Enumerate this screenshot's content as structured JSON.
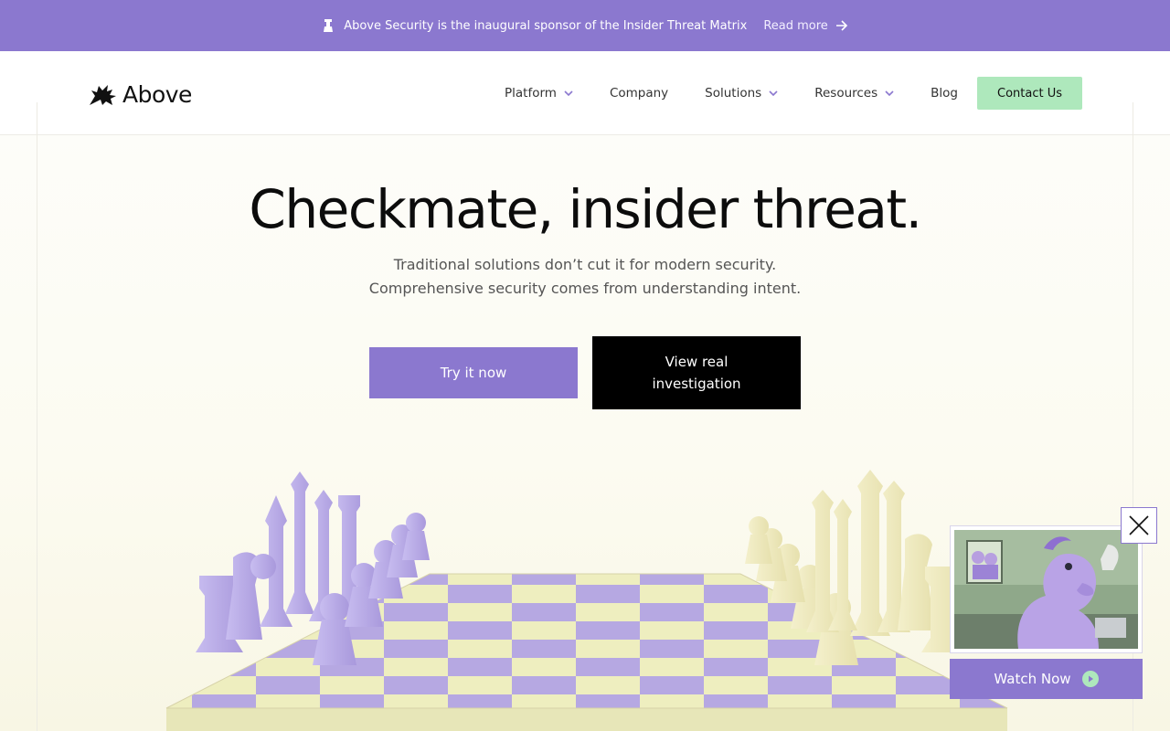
{
  "announcement": {
    "text": "Above Security is the inaugural sponsor of the Insider Threat Matrix",
    "link_label": "Read more"
  },
  "header": {
    "logo_text": "Above",
    "nav": [
      {
        "label": "Platform",
        "has_dropdown": true
      },
      {
        "label": "Company",
        "has_dropdown": false
      },
      {
        "label": "Solutions",
        "has_dropdown": true
      },
      {
        "label": "Resources",
        "has_dropdown": true
      },
      {
        "label": "Blog",
        "has_dropdown": false
      }
    ],
    "cta_label": "Contact Us"
  },
  "hero": {
    "title": "Checkmate, insider threat.",
    "subtitle_line1": "Traditional solutions don’t cut it for modern security.",
    "subtitle_line2": "Comprehensive security comes from understanding intent.",
    "primary_button": "Try it now",
    "secondary_button": "View real investigation"
  },
  "video_popup": {
    "watch_label": "Watch Now"
  },
  "colors": {
    "brand_purple": "#8b78cf",
    "cta_green": "#aee8bc",
    "board_yellow": "#eeeebc",
    "board_purple": "#b1a2e0"
  },
  "icons": {
    "announcement": "chess-pawn-icon",
    "read_more": "arrow-right-icon",
    "dropdown": "chevron-down-icon",
    "close": "close-icon",
    "play": "play-icon"
  }
}
